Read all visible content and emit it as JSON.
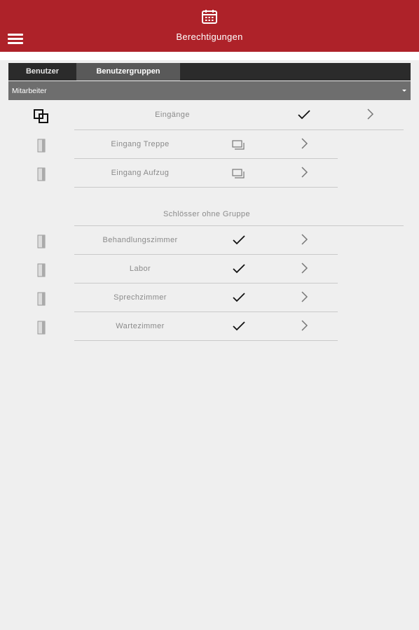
{
  "header": {
    "title": "Berechtigungen",
    "calendar_icon": "calendar-icon",
    "menu_icon": "hamburger-menu-icon",
    "color": "#ae2229"
  },
  "tabs": [
    {
      "label": "Benutzer",
      "active": false
    },
    {
      "label": "Benutzergruppen",
      "active": true
    }
  ],
  "dropdown": {
    "value": "Mitarbeiter"
  },
  "group": {
    "label": "Eingänge",
    "checked": true,
    "items": [
      {
        "label": "Eingang Treppe"
      },
      {
        "label": "Eingang Aufzug"
      }
    ]
  },
  "ungrouped": {
    "title": "Schlösser ohne Gruppe",
    "items": [
      {
        "label": "Behandlungszimmer",
        "checked": true
      },
      {
        "label": "Labor",
        "checked": true
      },
      {
        "label": "Sprechzimmer",
        "checked": true
      },
      {
        "label": "Wartezimmer",
        "checked": true
      }
    ]
  }
}
